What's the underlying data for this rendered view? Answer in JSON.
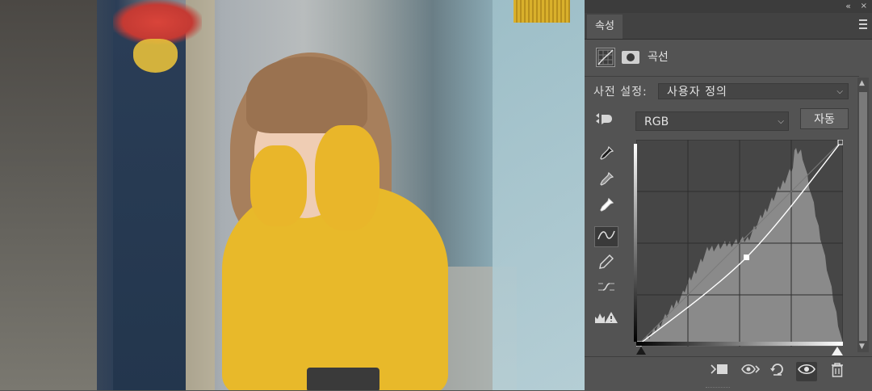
{
  "panel": {
    "tab_label": "속성",
    "adjustment_title": "곡선",
    "preset_label": "사전 설정:",
    "preset_value": "사용자 정의",
    "channel_value": "RGB",
    "auto_label": "자동"
  },
  "icons": {
    "collapse": "«",
    "close": "×",
    "chevron": "⌵",
    "target_adjust": "☛",
    "eyedropper": "✎",
    "curve_tool": "∿",
    "pencil": "✎",
    "smooth": "⇄",
    "clipping_warning": "⚠",
    "clip_layer": "⬚",
    "view_previous": "👁",
    "reset": "↺",
    "visibility": "👁",
    "delete": "🗑"
  },
  "colors": {
    "panel_bg": "#535353",
    "curve_line": "#ffffff",
    "histogram": "#8a8a8a",
    "grid_bg": "#464646"
  },
  "curve": {
    "points": [
      [
        0,
        0
      ],
      [
        136,
        110
      ],
      [
        255,
        255
      ]
    ]
  }
}
